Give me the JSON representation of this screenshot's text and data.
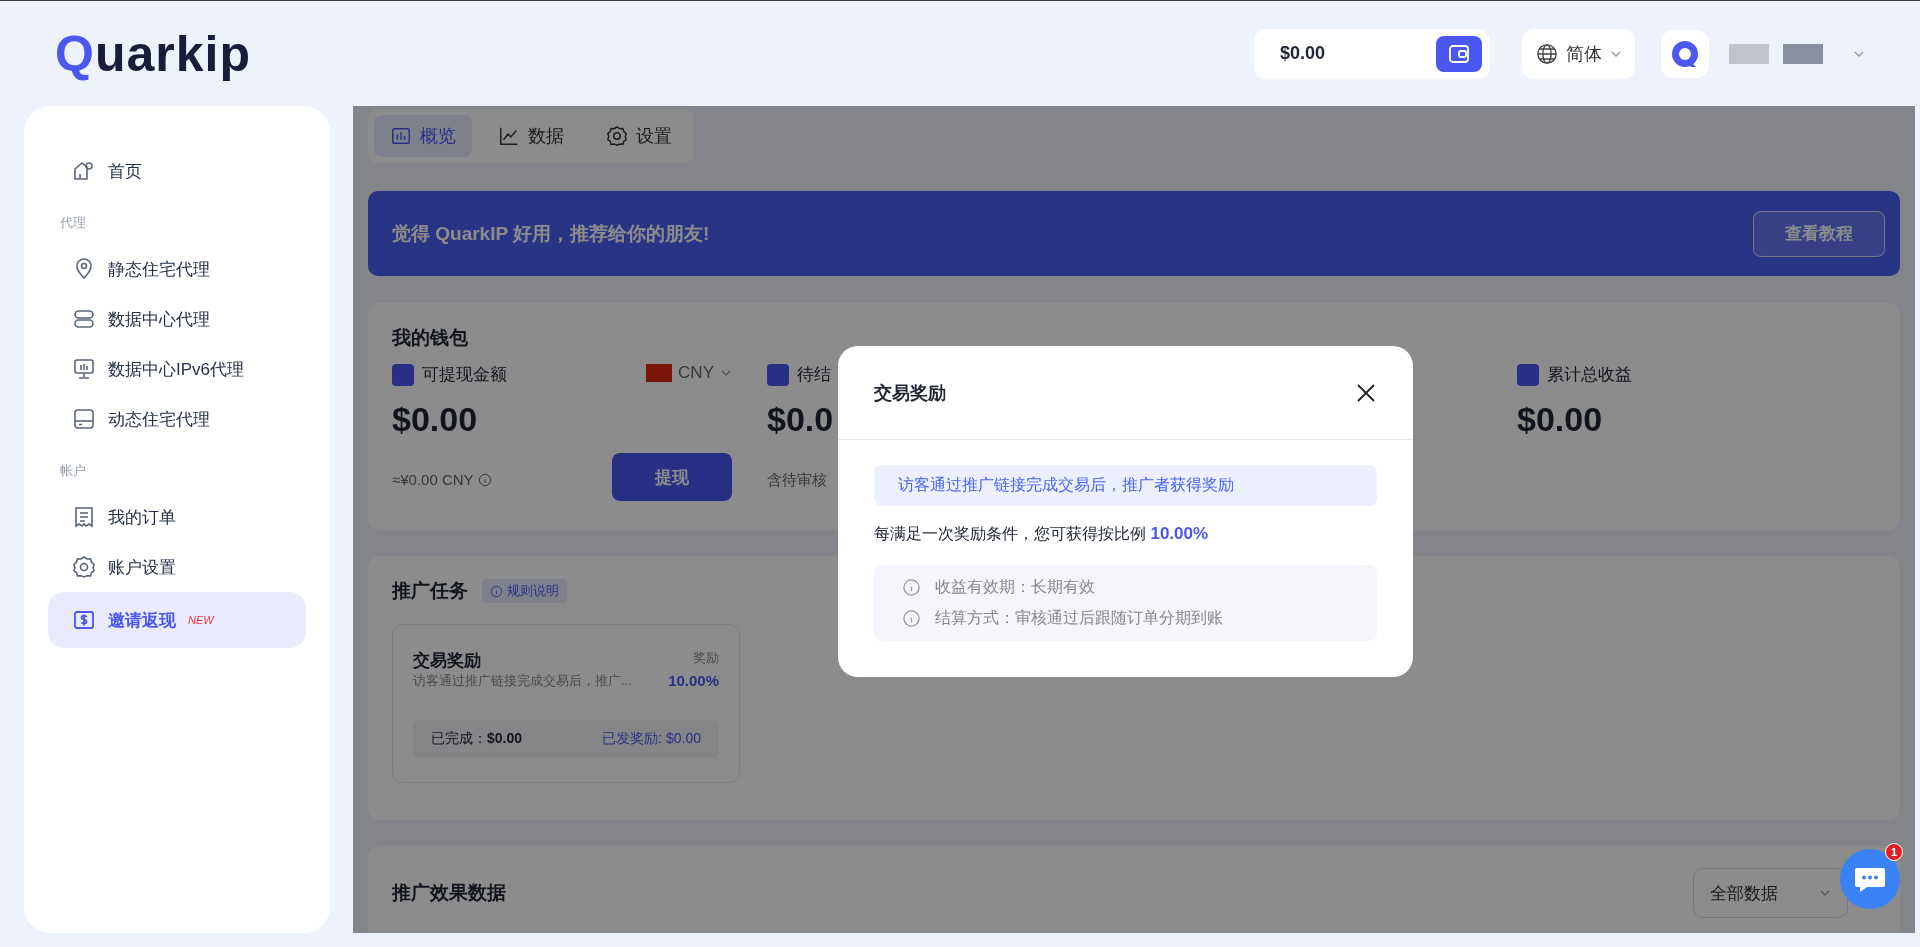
{
  "header": {
    "logo": "Quarkip",
    "balance": "$0.00",
    "language": "简体"
  },
  "sidebar": {
    "items": [
      {
        "kind": "item",
        "label": "首页",
        "selected": false
      },
      {
        "kind": "section",
        "label": "代理"
      },
      {
        "kind": "item",
        "label": "静态住宅代理",
        "selected": false
      },
      {
        "kind": "item",
        "label": "数据中心代理",
        "selected": false
      },
      {
        "kind": "item",
        "label": "数据中心IPv6代理",
        "selected": false
      },
      {
        "kind": "item",
        "label": "动态住宅代理",
        "selected": false
      },
      {
        "kind": "section",
        "label": "帐户"
      },
      {
        "kind": "item",
        "label": "我的订单",
        "selected": false
      },
      {
        "kind": "item",
        "label": "账户设置",
        "selected": false
      },
      {
        "kind": "item",
        "label": "邀请返现",
        "selected": true,
        "badge": "NEW"
      }
    ]
  },
  "tabs": [
    {
      "label": "概览",
      "selected": true
    },
    {
      "label": "数据",
      "selected": false
    },
    {
      "label": "设置",
      "selected": false
    }
  ],
  "banner": {
    "text": "觉得 QuarkIP 好用，推荐给你的朋友!",
    "button": "查看教程"
  },
  "wallet": {
    "title": "我的钱包",
    "columns": [
      {
        "label": "可提现金额",
        "amount": "$0.00",
        "note": "≈¥0.00 CNY",
        "currency": "CNY",
        "button": "提现"
      },
      {
        "label": "待结",
        "amount": "$0.0",
        "note": "含待审核"
      },
      {
        "label": "累计总收益",
        "amount": "$0.00"
      }
    ]
  },
  "tasks": {
    "title": "推广任务",
    "rules": "规则说明",
    "cards": [
      {
        "title": "交易奖励",
        "reward_label": "奖励",
        "description": "访客通过推广链接完成交易后，推广...",
        "rate": "10.00%",
        "completed": "已完成：**$0.00**",
        "paid": "已发奖励: $0.00"
      }
    ]
  },
  "stats": {
    "title": "推广效果数据",
    "filter": "全部数据"
  },
  "modal": {
    "title": "交易奖励",
    "notice": "访客通过推广链接完成交易后，推广者获得奖励",
    "rate_text": "每满足一次奖励条件，您可获得按比例",
    "rate": "10.00%",
    "info": [
      "收益有效期：长期有效",
      "结算方式：审核通过后跟随订单分期到账"
    ]
  },
  "chat": {
    "badge": "1"
  }
}
